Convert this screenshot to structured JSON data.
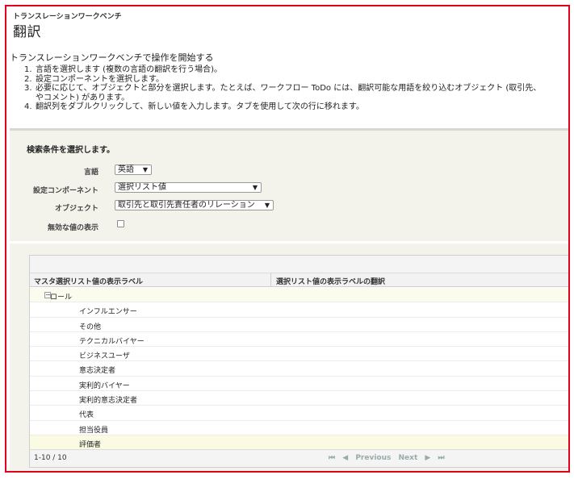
{
  "header": {
    "app_title": "トランスレーションワークベンチ",
    "page_title": "翻訳"
  },
  "intro": "トランスレーションワークベンチで操作を開始する",
  "steps": [
    {
      "num": "1.",
      "text": "言語を選択します (複数の言語の翻訳を行う場合)。"
    },
    {
      "num": "2.",
      "text": "設定コンポーネントを選択します。"
    },
    {
      "num": "3.",
      "text": "必要に応じて、オブジェクトと部分を選択します。たとえば、ワークフロー ToDo には、翻訳可能な用語を絞り込むオブジェクト (取引先、",
      "cont": "やコメント) があります。"
    },
    {
      "num": "4.",
      "text": "翻訳列をダブルクリックして、新しい値を入力します。タブを使用して次の行に移れます。"
    }
  ],
  "filter": {
    "title": "検索条件を選択します。",
    "language_label": "言語",
    "language_value": "英語",
    "component_label": "設定コンポーネント",
    "component_value": "選択リスト値",
    "object_label": "オブジェクト",
    "object_value": "取引先と取引先責任者のリレーション",
    "inactive_label": "無効な値の表示",
    "inactive_checked": false
  },
  "grid": {
    "col_master": "マスタ選択リスト値の表示ラベル",
    "col_translation": "選択リスト値の表示ラベルの翻訳",
    "group_label": "ロール",
    "rows": [
      "インフルエンサー",
      "その他",
      "テクニカルバイヤー",
      "ビジネスユーザ",
      "意志決定者",
      "実利的バイヤー",
      "実利的意志決定者",
      "代表",
      "担当役員",
      "評価者"
    ],
    "pager_count": "1-10 / 10",
    "pager_first": "⏮",
    "pager_prev_icon": "◀",
    "pager_prev": "Previous",
    "pager_next": "Next",
    "pager_next_icon": "▶",
    "pager_last": "⏭"
  }
}
